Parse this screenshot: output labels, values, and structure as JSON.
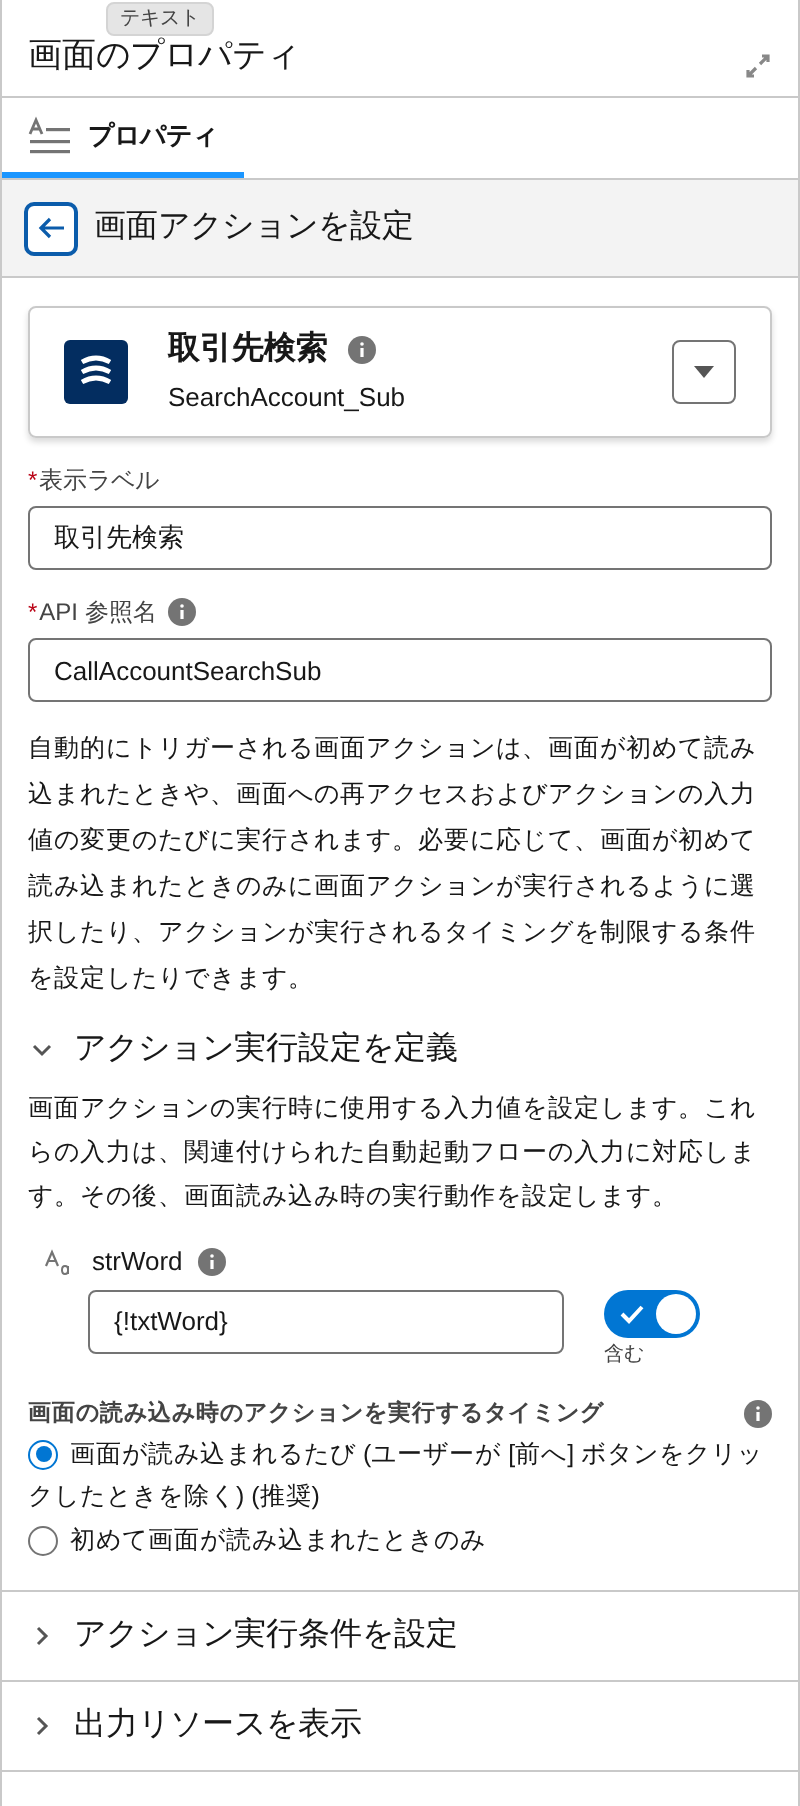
{
  "header": {
    "title": "画面のプロパティ",
    "tooltip": "テキスト"
  },
  "tabs": [
    {
      "label": "プロパティ",
      "selected": true
    }
  ],
  "subheader": {
    "title": "画面アクションを設定"
  },
  "action_card": {
    "name": "取引先検索",
    "api_name": "SearchAccount_Sub"
  },
  "fields": [
    {
      "label": "表示ラベル",
      "required_mark": "*",
      "info": false,
      "value": "取引先検索"
    },
    {
      "label": "API 参照名",
      "required_mark": "*",
      "info": true,
      "value": "CallAccountSearchSub"
    }
  ],
  "description": "自動的にトリガーされる画面アクションは、画面が初めて読み込まれたときや、画面への再アクセスおよびアクションの入力値の変更のたびに実行されます。必要に応じて、画面が初めて読み込まれたときのみに画面アクションが実行されるように選択したり、アクションが実行されるタイミングを制限する条件を設定したりできます。",
  "sections": [
    {
      "title": "アクション実行設定を定義",
      "expanded": true,
      "description": "画面アクションの実行時に使用する入力値を設定します。これらの入力は、関連付けられた自動起動フローの入力に対応します。その後、画面読み込み時の実行動作を設定します。",
      "input": {
        "name": "strWord",
        "value": "{!txtWord}",
        "toggle_label": "含む",
        "on": true
      },
      "timing": {
        "label": "画面の読み込み時のアクションを実行するタイミング",
        "options": [
          {
            "label": "画面が読み込まれるたび (ユーザーが [前へ] ボタンをクリックしたときを除く) (推奨)",
            "selected": true
          },
          {
            "label": "初めて画面が読み込まれたときのみ",
            "selected": false
          }
        ]
      }
    },
    {
      "title": "アクション実行条件を設定",
      "expanded": false
    },
    {
      "title": "出力リソースを表示",
      "expanded": false
    }
  ]
}
